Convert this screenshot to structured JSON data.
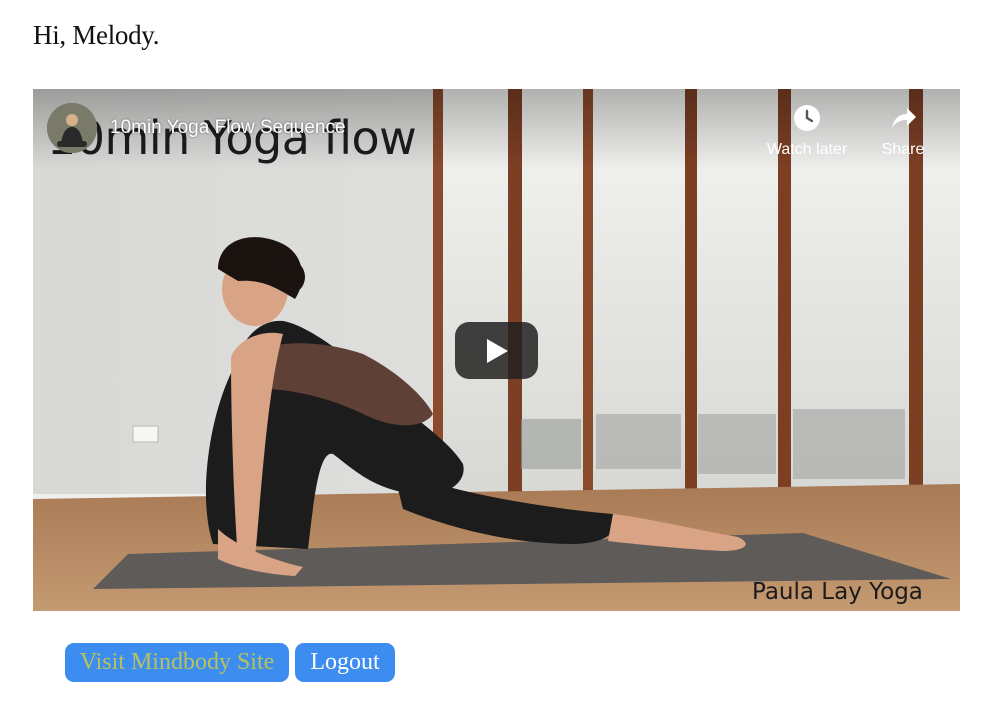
{
  "greeting": "Hi, Melody.",
  "video": {
    "title": "10min Yoga Flow Sequence",
    "overlay_title": "10min Yoga flow",
    "watch_later_label": "Watch later",
    "share_label": "Share",
    "watermark": "Paula Lay Yoga",
    "icons": {
      "play": "play-icon",
      "watch_later": "clock-icon",
      "share": "share-arrow-icon",
      "channel": "channel-avatar"
    }
  },
  "buttons": {
    "visit_label": "Visit Mindbody Site",
    "logout_label": "Logout"
  },
  "colors": {
    "button_bg": "#3d8df0",
    "visit_text": "#b7c35a",
    "logout_text": "#ffffff",
    "play_button_bg": "#212121"
  }
}
